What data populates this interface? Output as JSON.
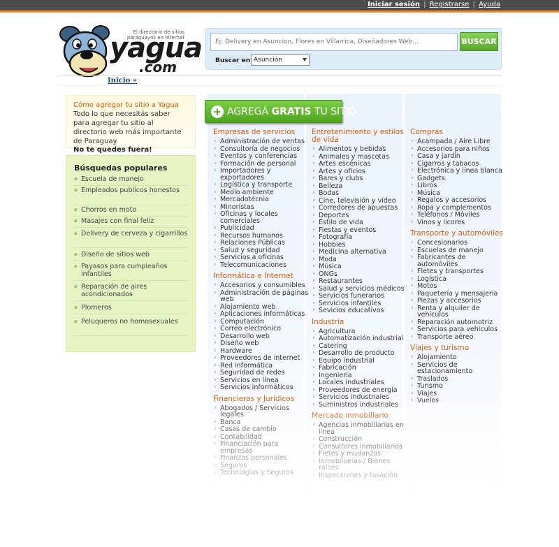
{
  "top_links": {
    "login": "Iniciar sesión",
    "register": "Registrarse",
    "help": "Ayuda",
    "separator": "|"
  },
  "header": {
    "tagline": "El directorio de sitios paraguayos en Internet",
    "brand_name": "yagua",
    "brand_suffix": ".com"
  },
  "search": {
    "placeholder": "Ej: Delivery en Asuncion, Flores en Villarrica, Diseñadores Web...",
    "button_label": "BUSCAR",
    "in_label": "Buscar en:",
    "location_selected": "Asunción"
  },
  "breadcrumb": "Inicio »",
  "promo": {
    "title": "Cómo agregar tu sitio a Yagua",
    "description": "Todo lo que necesitás saber para agregar tu sitio al directorio web más importante de Paraguay.",
    "strong": "No te quedes fuera!"
  },
  "popular": {
    "title": "Búsquedas populares",
    "items": [
      "Escuela de manejo",
      "Empleados publicos honestos",
      "Chorros en moto",
      "Masajes con final feliz",
      "Delivery de cerveza y cigarrillos",
      "Diseño de sitios web",
      "Payasos para cumpleaños infantiles",
      "Reparación de aires acondicionados",
      "Plomeros",
      "Peluqueros no homosexuales"
    ]
  },
  "cta": {
    "text_pre": "AGREGÁ ",
    "text_bold": "GRATIS",
    "text_post": " TU SITIO"
  },
  "columns": [
    [
      {
        "title": "Empresas de servicios",
        "items": [
          "Administración de ventas",
          "Consultoría de negocios",
          "Eventos y conferencias",
          "Formación de personal",
          "Importadores y exportadores",
          "Logística y transporte",
          "Medio ambiente",
          "Mercadotécnia",
          "Minoristas",
          "Oficinas y locales comerciales",
          "Publicidad",
          "Recursos humanos",
          "Relaciones Públicas",
          "Salud y seguridad",
          "Servicios a oficinas",
          "Telecomunicaciones"
        ]
      },
      {
        "title": "Informática e Internet",
        "items": [
          "Accesorios y consumibles",
          "Administración de páginas web",
          "Alojamiento web",
          "Aplicaciones informáticas",
          "Computación",
          "Correo electrónico",
          "Desarrollo web",
          "Diseño web",
          "Hardware",
          "Proveedores de internet",
          "Red informática",
          "Seguridad de redes",
          "Servicios en línea",
          "Servicios informáticos"
        ]
      },
      {
        "title": "Financieros y Jurídicos",
        "items": [
          "Abogados / Servicios legales",
          "Banca",
          "Casas de cambio",
          "Contabilidad",
          "Financiación para empresas",
          "Finanzas personales",
          "Seguros",
          "Tecnologías y Seguros"
        ]
      }
    ],
    [
      {
        "title": "Entretenimiento y estilos de vida",
        "items": [
          "Alimentos y bebidas",
          "Animales y mascotas",
          "Artes escénicas",
          "Artes y oficios",
          "Bares y clubs",
          "Belleza",
          "Bodas",
          "Cine, televisión y video",
          "Corredores de apuestas",
          "Deportes",
          "Estilo de vida",
          "Fiestas y eventos",
          "Fotografía",
          "Hobbies",
          "Medicina alternativa",
          "Moda",
          "Música",
          "ONGs",
          "Restaurantes",
          "Salud y servicios médicos",
          "Servicios funerarios",
          "Servicios infantiles",
          "Sevicios educativos"
        ]
      },
      {
        "title": "Industria",
        "items": [
          "Agricultura",
          "Automatización industrial",
          "Catering",
          "Desarrollo de producto",
          "Equipo industrial",
          "Fabricación",
          "Ingeniería",
          "Locales industriales",
          "Proveedores de energía",
          "Servicios industriales",
          "Suministros industriales"
        ]
      },
      {
        "title": "Mercado inmobiliario",
        "items": [
          "Agencias inmobiliarias en línea",
          "Construcción",
          "Consultores inmobiliarios",
          "Fletes y mudanzas",
          "Inmobiliarias / Bienes raíces",
          "Inspecciones y tasación"
        ]
      }
    ],
    [
      {
        "title": "Compras",
        "items": [
          "Acampada / Aire Libre",
          "Accesorios para niños",
          "Casa y jardín",
          "Cigarros y tabacos",
          "Electrónica y línea blanca",
          "Gadgets",
          "Libros",
          "Música",
          "Regalos y accesorios",
          "Ropa y complementos",
          "Teléfonos / Móviles",
          "Vinos y licores"
        ]
      },
      {
        "title": "Transporte y automóviles",
        "items": [
          "Concesionarios",
          "Escuelas de manejo",
          "Fabricantes de automóviles",
          "Fletes y transportes",
          "Logística",
          "Motos",
          "Paquetería y mensajería",
          "Piezas y accesorios",
          "Renta y alquiler de vehículos",
          "Reparación automotriz",
          "Servicios para vehículos",
          "Transporte aéreo"
        ]
      },
      {
        "title": "Viajes y turismo",
        "items": [
          "Alojamiento",
          "Servicios de estacionamiento",
          "Traslados",
          "Turismo",
          "Viajes",
          "Vuelos"
        ]
      }
    ]
  ]
}
